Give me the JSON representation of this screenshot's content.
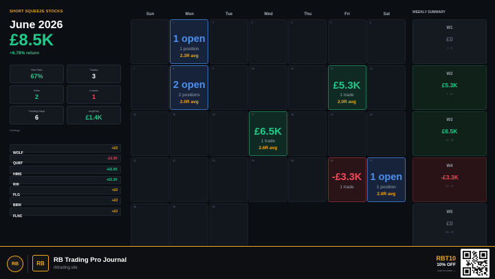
{
  "app": {
    "label": "SHORT SQUEEZE STOCKS"
  },
  "summary": {
    "month": "June 2026",
    "total": "£8.5K",
    "return": "+6.78% return"
  },
  "stats": [
    {
      "label": "Win Rate",
      "value": "67%",
      "color": "#22c98a"
    },
    {
      "label": "Trades",
      "value": "3",
      "color": "#ffffff"
    },
    {
      "label": "Wins",
      "value": "2",
      "color": "#22c98a"
    },
    {
      "label": "Losses",
      "value": "1",
      "color": "#f2495c"
    },
    {
      "label": "Trading Days",
      "value": "6",
      "color": "#ffffff"
    },
    {
      "label": "Avg/Day",
      "value": "£1.4K",
      "color": "#22c98a"
    }
  ],
  "holdings_title": "Holdings",
  "holdings": [
    {
      "ticker": "WOLF",
      "pnl": "+£0",
      "color": "#f2a81d"
    },
    {
      "ticker": "QUBT",
      "pnl": "-£3.3K",
      "color": "#f2495c"
    },
    {
      "ticker": "HIMS",
      "pnl": "+£6.5K",
      "color": "#22c98a"
    },
    {
      "ticker": "RHI",
      "pnl": "+£5.3K",
      "color": "#22c98a"
    },
    {
      "ticker": "FLG",
      "pnl": "+£0",
      "color": "#f2a81d"
    },
    {
      "ticker": "BIRK",
      "pnl": "+£0",
      "color": "#f2a81d"
    },
    {
      "ticker": "FLNC",
      "pnl": "+£0",
      "color": "#f2a81d"
    }
  ],
  "weekdays": [
    "Sun",
    "Mon",
    "Tue",
    "Wed",
    "Thu",
    "Fri",
    "Sat"
  ],
  "days": [
    {
      "day": "",
      "row": 0,
      "col": 0
    },
    {
      "day": "1",
      "row": 0,
      "col": 1,
      "type": "blue",
      "big": "1 open",
      "sub": "1 position",
      "avg": "2.3R avg"
    },
    {
      "day": "2",
      "row": 0,
      "col": 2
    },
    {
      "day": "3",
      "row": 0,
      "col": 3
    },
    {
      "day": "4",
      "row": 0,
      "col": 4
    },
    {
      "day": "5",
      "row": 0,
      "col": 5
    },
    {
      "day": "6",
      "row": 0,
      "col": 6
    },
    {
      "day": "7",
      "row": 1,
      "col": 0
    },
    {
      "day": "8",
      "row": 1,
      "col": 1,
      "type": "blue",
      "big": "2 open",
      "sub": "2 positions",
      "avg": "2.0R avg"
    },
    {
      "day": "9",
      "row": 1,
      "col": 2
    },
    {
      "day": "10",
      "row": 1,
      "col": 3
    },
    {
      "day": "11",
      "row": 1,
      "col": 4
    },
    {
      "day": "12",
      "row": 1,
      "col": 5,
      "type": "green",
      "big": "£5.3K",
      "sub": "1 trade",
      "avg": "2.0R avg"
    },
    {
      "day": "13",
      "row": 1,
      "col": 6
    },
    {
      "day": "14",
      "row": 2,
      "col": 0
    },
    {
      "day": "15",
      "row": 2,
      "col": 1
    },
    {
      "day": "16",
      "row": 2,
      "col": 2
    },
    {
      "day": "17",
      "row": 2,
      "col": 3,
      "type": "green",
      "big": "£6.5K",
      "sub": "1 trade",
      "avg": "2.6R avg"
    },
    {
      "day": "18",
      "row": 2,
      "col": 4
    },
    {
      "day": "19",
      "row": 2,
      "col": 5
    },
    {
      "day": "20",
      "row": 2,
      "col": 6
    },
    {
      "day": "21",
      "row": 3,
      "col": 0
    },
    {
      "day": "22",
      "row": 3,
      "col": 1
    },
    {
      "day": "23",
      "row": 3,
      "col": 2
    },
    {
      "day": "24",
      "row": 3,
      "col": 3
    },
    {
      "day": "25",
      "row": 3,
      "col": 4
    },
    {
      "day": "26",
      "row": 3,
      "col": 5,
      "type": "red",
      "big": "-£3.3K",
      "sub": "1 trade",
      "avg": ""
    },
    {
      "day": "27",
      "row": 3,
      "col": 6,
      "type": "blue",
      "big": "1 open",
      "sub": "1 position",
      "avg": "2.0R avg"
    },
    {
      "day": "28",
      "row": 4,
      "col": 0
    },
    {
      "day": "29",
      "row": 4,
      "col": 1
    },
    {
      "day": "30",
      "row": 4,
      "col": 2
    }
  ],
  "weekly_title": "WEEKLY SUMMARY",
  "weeks": [
    {
      "label": "W1",
      "value": "£0",
      "range": "1 - 6",
      "type": "neutral"
    },
    {
      "label": "W2",
      "value": "£5.3K",
      "range": "7 - 13",
      "type": "green"
    },
    {
      "label": "W3",
      "value": "£6.5K",
      "range": "14 - 20",
      "type": "green"
    },
    {
      "label": "W4",
      "value": "-£3.3K",
      "range": "21 - 27",
      "type": "red"
    },
    {
      "label": "W5",
      "value": "£0",
      "range": "28 - 30",
      "type": "neutral"
    }
  ],
  "footer": {
    "badge": "RB",
    "logo": "RB",
    "brand": "RB Trading Pro Journal",
    "site": "rbtrading.site",
    "promo_code": "RBT10",
    "promo_off": "10% OFF",
    "scan": "scan to claim →"
  },
  "colors": {
    "accent": "#f2a81d",
    "positive": "#22c98a",
    "negative": "#f2495c",
    "open": "#4d8ff0"
  }
}
